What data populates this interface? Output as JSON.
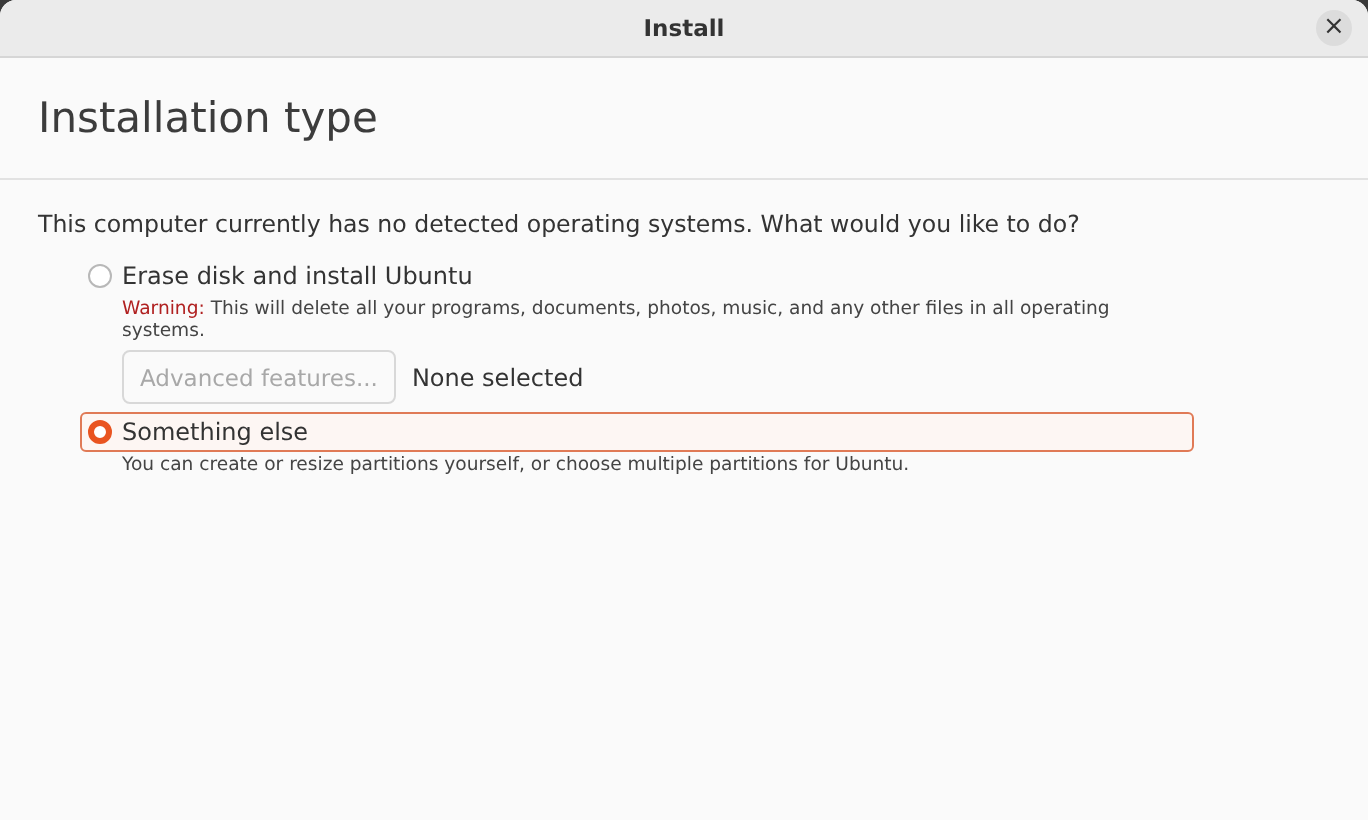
{
  "window": {
    "title": "Install",
    "close": "×"
  },
  "page_title": "Installation type",
  "question": "This computer currently has no detected operating systems. What would you like to do?",
  "options": [
    {
      "label": "Erase disk and install Ubuntu",
      "selected": false,
      "warning": {
        "prefix": "Warning:",
        "text": " This will delete all your programs, documents, photos, music, and any other files in all operating systems."
      },
      "advanced_button": {
        "label": "Advanced features...",
        "disabled": true
      },
      "advanced_status": "None selected"
    },
    {
      "label": "Something else",
      "selected": true,
      "description": "You can create or resize partitions yourself, or choose multiple partitions for Ubuntu."
    }
  ]
}
